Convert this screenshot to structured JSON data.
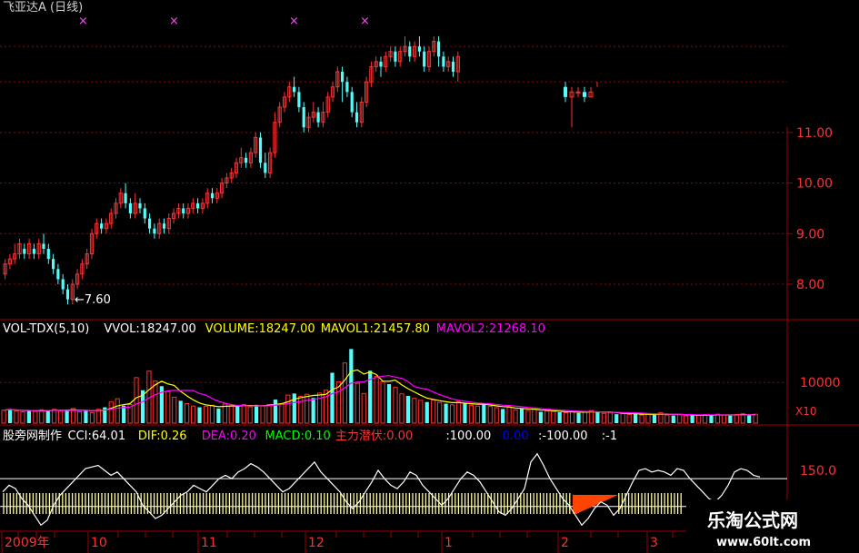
{
  "title": "飞亚达A (日线)",
  "colors": {
    "up": "#ff3232",
    "down": "#54fcfc",
    "grid": "#a00000",
    "white": "#ffffff",
    "yellow": "#ffff00",
    "magenta": "#ff00ff",
    "green": "#00ff00",
    "blue": "#0000ff",
    "cyan": "#54fcfc",
    "orange": "#ff4400",
    "stripe": "#ffff99",
    "marker": "#ff44ff"
  },
  "price_panel": {
    "y_ticks": [
      "11.00",
      "10.00",
      "9.00",
      "8.00"
    ],
    "low_label": "←7.60",
    "markers": [
      "×",
      "×",
      "×",
      "×"
    ]
  },
  "volume_panel": {
    "legend": [
      {
        "text": "VOL-TDX(5,10)",
        "color": "white"
      },
      {
        "text": "VVOL:18247.00",
        "color": "white"
      },
      {
        "text": "VOLUME:18247.00",
        "color": "yellow"
      },
      {
        "text": "MAVOL1:21457.80",
        "color": "yellow"
      },
      {
        "text": "MAVOL2:21268.10",
        "color": "magenta"
      }
    ],
    "y_tick": "10000",
    "unit_label": "X10"
  },
  "indicator_panel": {
    "legend": [
      {
        "text": "股旁网制作",
        "color": "white"
      },
      {
        "text": "CCI:64.01",
        "color": "white"
      },
      {
        "text": "DIF:0.26",
        "color": "yellow"
      },
      {
        "text": "DEA:0.20",
        "color": "magenta"
      },
      {
        "text": "MACD:0.10",
        "color": "green"
      },
      {
        "text": "主力潜伏:0.00",
        "color": "up"
      },
      {
        "text": ":100.00",
        "color": "white"
      },
      {
        "text": "0.00",
        "color": "blue"
      },
      {
        "text": ":-100.00",
        "color": "white"
      },
      {
        "text": ":-1",
        "color": "white"
      }
    ],
    "y_tick": "150.0"
  },
  "x_axis": {
    "labels": [
      "2009年",
      "10",
      "11",
      "12",
      "1",
      "2",
      "3"
    ]
  },
  "watermark": {
    "title": "乐淘公式网",
    "url": "www.60lt.com"
  },
  "chart_data": {
    "type": "candlestick",
    "title": "飞亚达A (日线)",
    "x_labels": [
      "2009年",
      "10",
      "11",
      "12",
      "1",
      "2",
      "3"
    ],
    "price_ylim": [
      7.3,
      12.0
    ],
    "price_ticks": [
      8,
      9,
      10,
      11
    ],
    "low_marker": 7.6,
    "candles": [
      [
        8.2,
        8.4,
        8.1,
        8.5
      ],
      [
        8.4,
        8.5,
        8.3,
        8.6
      ],
      [
        8.5,
        8.6,
        8.4,
        8.8
      ],
      [
        8.6,
        8.8,
        8.5,
        8.9
      ],
      [
        8.7,
        8.6,
        8.5,
        8.8
      ],
      [
        8.6,
        8.8,
        8.5,
        8.9
      ],
      [
        8.7,
        8.6,
        8.5,
        8.8
      ],
      [
        8.6,
        8.8,
        8.5,
        8.9
      ],
      [
        8.8,
        8.7,
        8.6,
        9.0
      ],
      [
        8.7,
        8.5,
        8.4,
        8.8
      ],
      [
        8.5,
        8.3,
        8.2,
        8.6
      ],
      [
        8.3,
        8.1,
        8.0,
        8.4
      ],
      [
        8.1,
        7.9,
        7.8,
        8.2
      ],
      [
        7.9,
        7.7,
        7.6,
        8.0
      ],
      [
        7.7,
        8.0,
        7.6,
        8.1
      ],
      [
        8.0,
        8.2,
        7.9,
        8.3
      ],
      [
        8.2,
        8.4,
        8.1,
        8.5
      ],
      [
        8.4,
        8.6,
        8.3,
        8.7
      ],
      [
        8.6,
        9.0,
        8.5,
        9.1
      ],
      [
        9.0,
        9.2,
        8.9,
        9.3
      ],
      [
        9.2,
        9.1,
        9.0,
        9.3
      ],
      [
        9.1,
        9.2,
        9.0,
        9.3
      ],
      [
        9.2,
        9.4,
        9.1,
        9.5
      ],
      [
        9.4,
        9.6,
        9.3,
        9.7
      ],
      [
        9.6,
        9.8,
        9.5,
        9.9
      ],
      [
        9.8,
        9.6,
        9.5,
        10.0
      ],
      [
        9.6,
        9.4,
        9.3,
        9.7
      ],
      [
        9.4,
        9.6,
        9.3,
        9.8
      ],
      [
        9.6,
        9.5,
        9.4,
        9.7
      ],
      [
        9.5,
        9.3,
        9.2,
        9.6
      ],
      [
        9.3,
        9.1,
        9.0,
        9.4
      ],
      [
        9.1,
        9.0,
        8.9,
        9.2
      ],
      [
        9.0,
        9.2,
        8.9,
        9.3
      ],
      [
        9.2,
        9.1,
        9.0,
        9.3
      ],
      [
        9.1,
        9.3,
        9.0,
        9.4
      ],
      [
        9.3,
        9.4,
        9.2,
        9.5
      ],
      [
        9.4,
        9.5,
        9.3,
        9.6
      ],
      [
        9.5,
        9.4,
        9.3,
        9.6
      ],
      [
        9.4,
        9.5,
        9.3,
        9.6
      ],
      [
        9.5,
        9.6,
        9.4,
        9.7
      ],
      [
        9.6,
        9.5,
        9.4,
        9.7
      ],
      [
        9.5,
        9.6,
        9.4,
        9.7
      ],
      [
        9.6,
        9.8,
        9.5,
        9.9
      ],
      [
        9.8,
        9.7,
        9.6,
        9.9
      ],
      [
        9.7,
        9.8,
        9.6,
        9.9
      ],
      [
        9.8,
        10.0,
        9.7,
        10.1
      ],
      [
        10.0,
        10.1,
        9.9,
        10.2
      ],
      [
        10.1,
        10.2,
        10.0,
        10.3
      ],
      [
        10.2,
        10.4,
        10.1,
        10.5
      ],
      [
        10.4,
        10.5,
        10.3,
        10.7
      ],
      [
        10.5,
        10.4,
        10.3,
        10.6
      ],
      [
        10.4,
        10.6,
        10.3,
        10.7
      ],
      [
        10.6,
        10.9,
        10.5,
        11.0
      ],
      [
        10.9,
        10.4,
        10.3,
        11.0
      ],
      [
        10.4,
        10.2,
        10.1,
        10.6
      ],
      [
        10.2,
        10.6,
        10.1,
        10.7
      ],
      [
        10.6,
        11.2,
        10.5,
        11.4
      ],
      [
        11.2,
        11.5,
        11.1,
        11.6
      ],
      [
        11.5,
        11.7,
        11.4,
        11.8
      ],
      [
        11.7,
        11.9,
        11.6,
        12.0
      ],
      [
        11.9,
        11.8,
        11.7,
        12.1
      ],
      [
        11.8,
        11.5,
        11.4,
        11.9
      ],
      [
        11.5,
        11.1,
        11.0,
        11.6
      ],
      [
        11.1,
        11.3,
        11.0,
        11.4
      ],
      [
        11.3,
        11.4,
        11.2,
        11.6
      ],
      [
        11.4,
        11.2,
        11.1,
        11.5
      ],
      [
        11.2,
        11.4,
        11.1,
        11.6
      ],
      [
        11.4,
        11.7,
        11.3,
        11.8
      ],
      [
        11.7,
        11.9,
        11.6,
        12.0
      ],
      [
        11.9,
        12.2,
        11.8,
        12.3
      ],
      [
        12.2,
        12.0,
        11.6,
        12.3
      ],
      [
        12.0,
        11.8,
        11.7,
        12.1
      ],
      [
        11.8,
        11.4,
        11.3,
        11.9
      ],
      [
        11.4,
        11.2,
        11.1,
        11.6
      ],
      [
        11.2,
        11.6,
        11.1,
        11.7
      ],
      [
        11.6,
        12.0,
        11.5,
        12.1
      ],
      [
        12.0,
        12.3,
        11.9,
        12.4
      ],
      [
        12.3,
        12.4,
        12.2,
        12.5
      ],
      [
        12.4,
        12.3,
        12.1,
        12.5
      ],
      [
        12.3,
        12.5,
        12.2,
        12.6
      ],
      [
        12.5,
        12.6,
        12.4,
        12.7
      ],
      [
        12.6,
        12.4,
        12.3,
        12.7
      ],
      [
        12.4,
        12.6,
        12.3,
        12.7
      ],
      [
        12.6,
        12.7,
        12.5,
        12.9
      ],
      [
        12.7,
        12.5,
        12.4,
        12.8
      ],
      [
        12.5,
        12.7,
        12.4,
        12.8
      ],
      [
        12.7,
        12.6,
        12.5,
        12.9
      ],
      [
        12.6,
        12.3,
        12.2,
        12.7
      ],
      [
        12.3,
        12.6,
        12.2,
        12.7
      ],
      [
        12.6,
        12.8,
        12.5,
        12.9
      ],
      [
        12.8,
        12.5,
        12.3,
        12.9
      ],
      [
        12.5,
        12.3,
        12.2,
        12.6
      ],
      [
        12.3,
        12.4,
        12.2,
        12.5
      ],
      [
        12.4,
        12.2,
        12.1,
        12.5
      ],
      [
        12.2,
        12.5,
        12.0,
        12.6
      ]
    ],
    "late_candles": [
      [
        11.9,
        11.7,
        11.6,
        12.0
      ],
      [
        11.7,
        11.8,
        11.1,
        11.9
      ],
      [
        11.8,
        11.8,
        11.7,
        11.9
      ],
      [
        11.8,
        11.7,
        11.6,
        11.9
      ],
      [
        11.7,
        11.8,
        11.7,
        11.9
      ]
    ],
    "volume_unit": "X10",
    "volume_ylim": [
      0,
      25000
    ],
    "volume": [
      3200,
      3500,
      3000,
      2800,
      3100,
      2900,
      3300,
      3100,
      3400,
      3000,
      3200,
      3600,
      2800,
      3100,
      2600,
      3400,
      3900,
      5200,
      6000,
      4300,
      4600,
      11200,
      8100,
      12800,
      10400,
      9100,
      7800,
      6400,
      5500,
      4800,
      4200,
      3900,
      4100,
      4400,
      3600,
      4700,
      4300,
      4100,
      4600,
      4000,
      4500,
      4200,
      4600,
      5800,
      4800,
      6900,
      7300,
      6600,
      7100,
      6200,
      7400,
      8100,
      12400,
      10200,
      14800,
      18247,
      9800,
      7300,
      12900,
      11500,
      10200,
      9600,
      8800,
      7200,
      6700,
      6100,
      5600,
      5200,
      5700,
      5100,
      4800,
      4500,
      5300,
      4900,
      4400,
      4200,
      4700,
      4100,
      3800,
      3500,
      3900,
      3300,
      3600,
      3100,
      3400,
      2800,
      3000,
      2900,
      2700,
      2600,
      2800,
      2500,
      2900,
      3100,
      2700,
      2400,
      2600,
      2200,
      2400,
      2100,
      2300,
      2000,
      2200,
      2100,
      2600,
      2000,
      1900,
      2100,
      1800,
      2000,
      1900,
      2100,
      1800,
      2200,
      2000,
      1900,
      2100,
      2300,
      2000,
      2200
    ],
    "mavol1_last": 21457.8,
    "mavol2_last": 21268.1,
    "cci_last": 64.01,
    "dif_last": 0.26,
    "dea_last": 0.2,
    "macd_last": 0.1,
    "cci": [
      20,
      60,
      40,
      -20,
      -60,
      -120,
      -180,
      -150,
      -60,
      0,
      40,
      80,
      120,
      160,
      170,
      180,
      150,
      120,
      140,
      100,
      60,
      20,
      -60,
      -100,
      -140,
      -120,
      -80,
      -40,
      0,
      20,
      60,
      40,
      20,
      60,
      100,
      120,
      100,
      140,
      160,
      190,
      170,
      140,
      100,
      60,
      20,
      40,
      80,
      120,
      160,
      200,
      140,
      100,
      60,
      20,
      -40,
      -80,
      -40,
      20,
      80,
      150,
      100,
      60,
      40,
      80,
      140,
      120,
      60,
      20,
      -20,
      -60,
      -20,
      40,
      100,
      140,
      120,
      80,
      20,
      -40,
      -100,
      -120,
      -80,
      -20,
      40,
      200,
      250,
      180,
      100,
      40,
      -20,
      -60,
      -120,
      -180,
      -140,
      -80,
      -40,
      -60,
      -120,
      -80,
      0,
      80,
      150,
      160,
      140,
      150,
      140,
      120,
      160,
      150,
      100,
      60,
      20,
      -20,
      -40,
      0,
      60,
      140,
      160,
      150,
      120,
      110
    ],
    "cci_lines": [
      100,
      -100
    ]
  }
}
